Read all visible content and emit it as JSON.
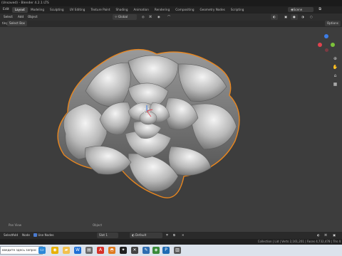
{
  "window": {
    "title": "(Unsaved) - Blender 4.2.1 LTS"
  },
  "menubar": {
    "items": [
      "Edit"
    ],
    "tabs": [
      "Layout",
      "Modeling",
      "Sculpting",
      "UV Editing",
      "Texture Paint",
      "Shading",
      "Animation",
      "Rendering",
      "Compositing",
      "Geometry Nodes",
      "Scripting"
    ],
    "active_tab": "Layout",
    "scene": "Scene"
  },
  "viewport_header": {
    "menu": [
      "Select",
      "Add",
      "Object"
    ],
    "orientation": "Global",
    "options": "Options"
  },
  "tool_header": {
    "mode_partial": "ting",
    "select_box": "Select Box"
  },
  "node_header": {
    "items": [
      "Select",
      "Add",
      "Node"
    ],
    "use_nodes_label": "Use Nodes",
    "slot": "Slot 1",
    "material": "Default"
  },
  "statusline": {
    "pan_view": "Pan View",
    "object": "Object",
    "stats": "Collection | Lid | Verts 2,161,201 | Faces 4,732,478 | Tris 4"
  },
  "taskbar": {
    "search_placeholder": "введите здесь запрос"
  },
  "colors": {
    "selection_outline": "#e8861f",
    "axis_x": "#e0424e",
    "axis_y": "#7cc23a",
    "axis_z": "#3d7de6"
  }
}
